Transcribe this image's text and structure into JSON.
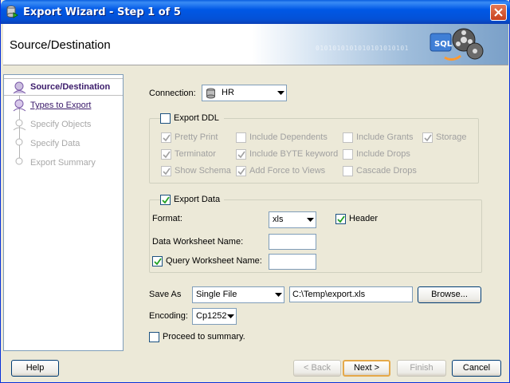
{
  "window": {
    "title": "Export Wizard - Step 1 of 5"
  },
  "banner": {
    "title": "Source/Destination",
    "graphic_text": "0101010101010101010101"
  },
  "nav": {
    "items": [
      {
        "label": "Source/Destination",
        "state": "active"
      },
      {
        "label": "Types to Export",
        "state": "link"
      },
      {
        "label": "Specify Objects",
        "state": "disabled"
      },
      {
        "label": "Specify Data",
        "state": "disabled"
      },
      {
        "label": "Export Summary",
        "state": "disabled"
      }
    ]
  },
  "connection": {
    "label": "Connection:",
    "value": "HR"
  },
  "export_ddl": {
    "label": "Export DDL",
    "checked": false,
    "options": [
      {
        "label": "Pretty Print",
        "checked": true
      },
      {
        "label": "Include Dependents",
        "checked": false
      },
      {
        "label": "Include Grants",
        "checked": false
      },
      {
        "label": "Storage",
        "checked": true
      },
      {
        "label": "Terminator",
        "checked": true
      },
      {
        "label": "Include BYTE keyword",
        "checked": true
      },
      {
        "label": "Include Drops",
        "checked": false
      },
      {
        "label": "Show Schema",
        "checked": true
      },
      {
        "label": "Add Force to Views",
        "checked": true
      },
      {
        "label": "Cascade Drops",
        "checked": false
      }
    ]
  },
  "export_data": {
    "label": "Export Data",
    "checked": true,
    "format_label": "Format:",
    "format_value": "xls",
    "header_label": "Header",
    "header_checked": true,
    "data_ws_label": "Data Worksheet Name:",
    "data_ws_value": "",
    "query_ws_label": "Query Worksheet Name:",
    "query_ws_checked": true,
    "query_ws_value": ""
  },
  "save_as": {
    "label": "Save As",
    "mode": "Single File",
    "path": "C:\\Temp\\export.xls",
    "browse_label": "Browse..."
  },
  "encoding": {
    "label": "Encoding:",
    "value": "Cp1252"
  },
  "proceed": {
    "label": "Proceed to summary.",
    "checked": false
  },
  "buttons": {
    "help": "Help",
    "back": "< Back",
    "next": "Next >",
    "finish": "Finish",
    "cancel": "Cancel"
  }
}
